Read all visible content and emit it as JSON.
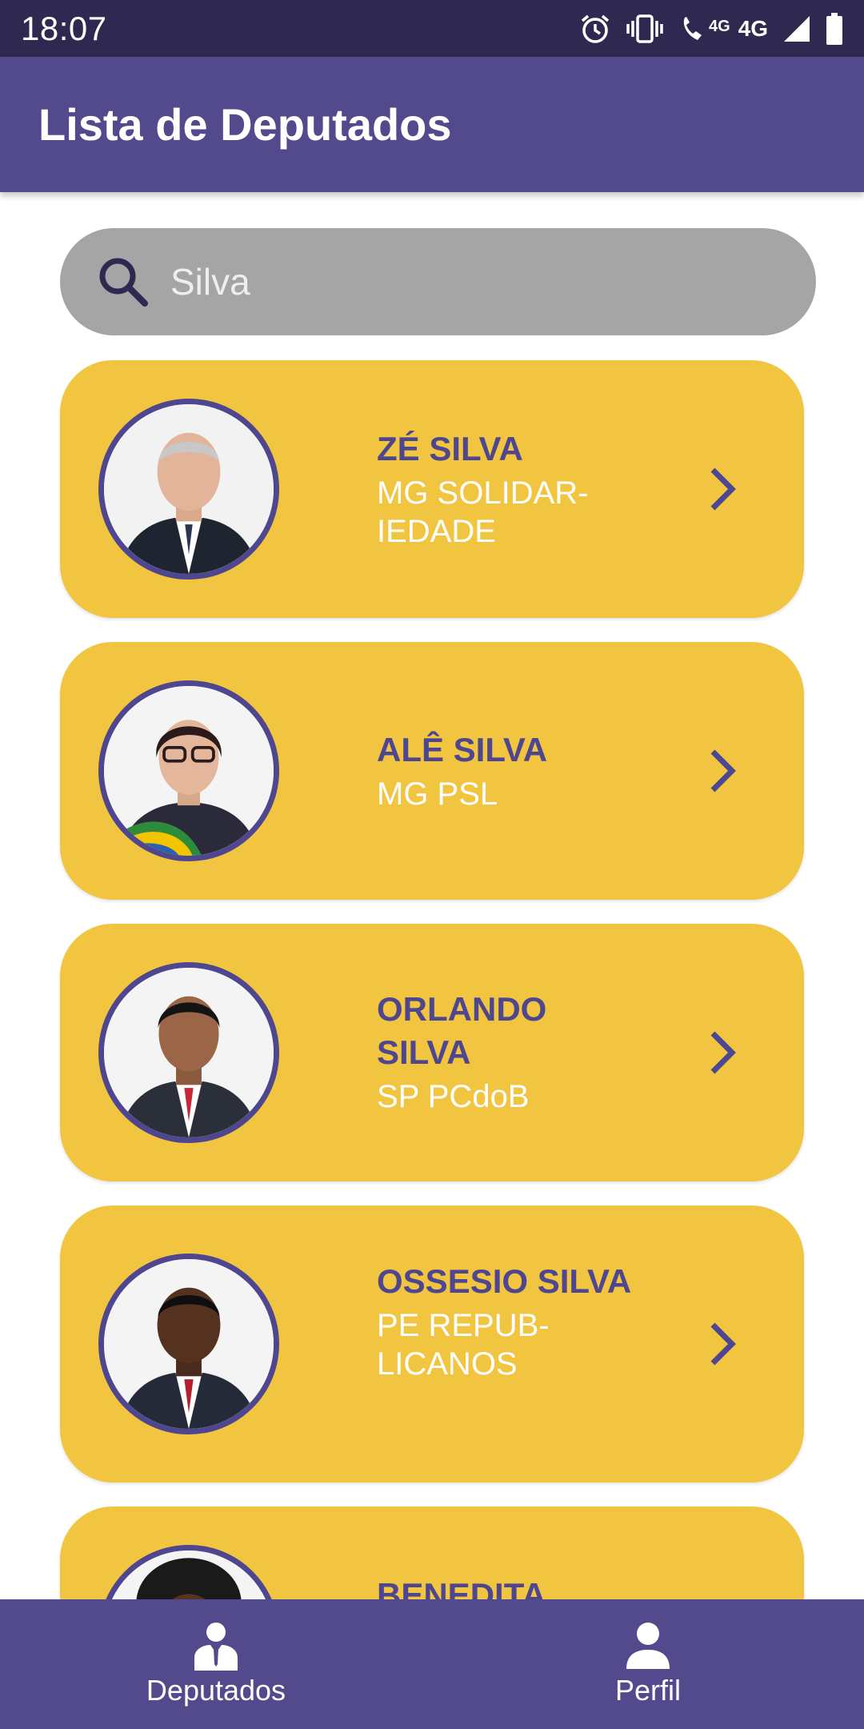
{
  "status_bar": {
    "time": "18:07",
    "network_small": "4G",
    "network_large": "4G",
    "icons": [
      "alarm-icon",
      "vibrate-icon",
      "wifi-calling-icon",
      "signal-icon",
      "battery-icon"
    ]
  },
  "app_bar": {
    "title": "Lista de Deputados"
  },
  "search": {
    "value": "",
    "placeholder": "Silva",
    "icon": "search-icon"
  },
  "deputies": [
    {
      "name": "ZÉ SILVA",
      "party": "MG SOLIDAR-IEDADE"
    },
    {
      "name": "ALÊ SILVA",
      "party": "MG PSL"
    },
    {
      "name": "ORLANDO SILVA",
      "party": "SP PCdoB"
    },
    {
      "name": "OSSESIO SILVA",
      "party": "PE REPUB-LICANOS"
    },
    {
      "name": "BENEDITA",
      "party": ""
    }
  ],
  "bottom_nav": {
    "items": [
      {
        "label": "Deputados",
        "icon": "deputy-icon"
      },
      {
        "label": "Perfil",
        "icon": "person-icon"
      }
    ]
  },
  "colors": {
    "status_bar": "#2f2850",
    "primary": "#524a8c",
    "accent_purple": "#4f4690",
    "card": "#f1c540",
    "search_bg": "#a5a5a5"
  }
}
